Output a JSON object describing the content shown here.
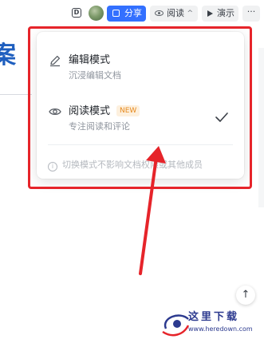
{
  "toolbar": {
    "share_label": "分享",
    "read_label": "阅读",
    "present_label": "演示",
    "more_label": "···"
  },
  "document": {
    "title_fragment": "案"
  },
  "mode_menu": {
    "edit": {
      "title": "编辑模式",
      "description": "沉浸编辑文档",
      "icon": "pencil-icon"
    },
    "read": {
      "title": "阅读模式",
      "badge": "NEW",
      "description": "专注阅读和评论",
      "icon": "eye-icon",
      "selected": true
    },
    "tip": "切换模式不影响文档权限或其他成员"
  },
  "colors": {
    "accent": "#3370ff",
    "annotation_red": "#e6242a",
    "badge_orange": "#e6891d"
  },
  "watermark": {
    "text": "这里下载",
    "url": "www.heredown.com"
  }
}
